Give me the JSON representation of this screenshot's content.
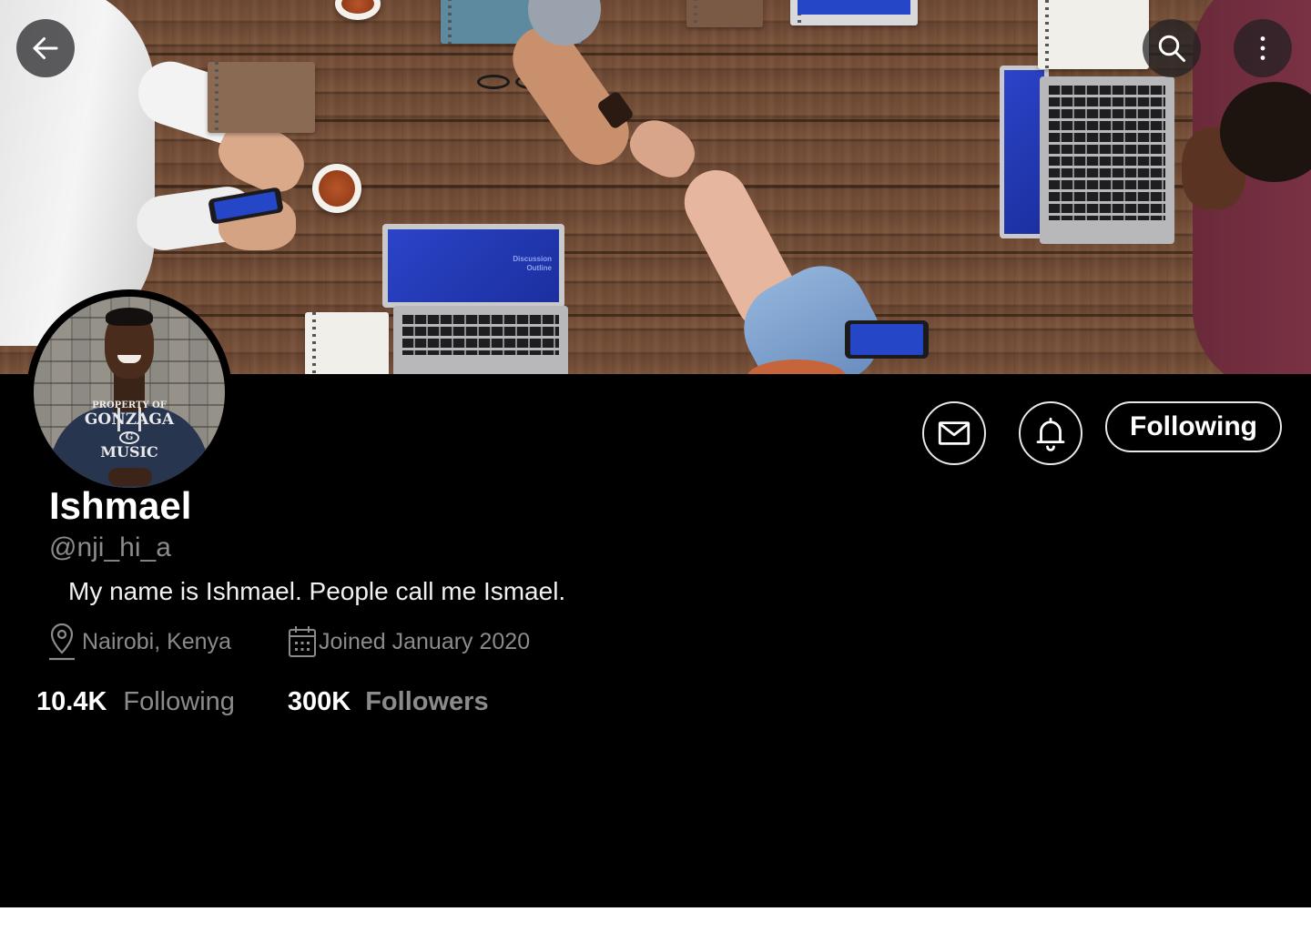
{
  "colors": {
    "background": "#000000",
    "primary_text": "#ffffff",
    "secondary_text": "#8b8b8b",
    "button_border": "#e8e8e8"
  },
  "header": {
    "back_icon": "arrow-left-icon",
    "search_icon": "search-icon",
    "more_icon": "more-vertical-icon"
  },
  "profile": {
    "name": "Ishmael",
    "handle": "@nji_hi_a",
    "bio": "My name is Ishmael. People call me Ismael.",
    "location": "Nairobi, Kenya",
    "joined": "Joined January 2020",
    "avatar_text": [
      "PROPERTY OF",
      "GONZAGA",
      "G",
      "MUSIC"
    ]
  },
  "banner": {
    "laptop_text": [
      "Discussion",
      "Outline"
    ]
  },
  "actions": {
    "message_icon": "mail-icon",
    "notify_icon": "bell-icon",
    "follow_label": "Following"
  },
  "stats": {
    "following_count": "10.4K",
    "following_label": "Following",
    "followers_count": "300K",
    "followers_label": "Followers"
  }
}
